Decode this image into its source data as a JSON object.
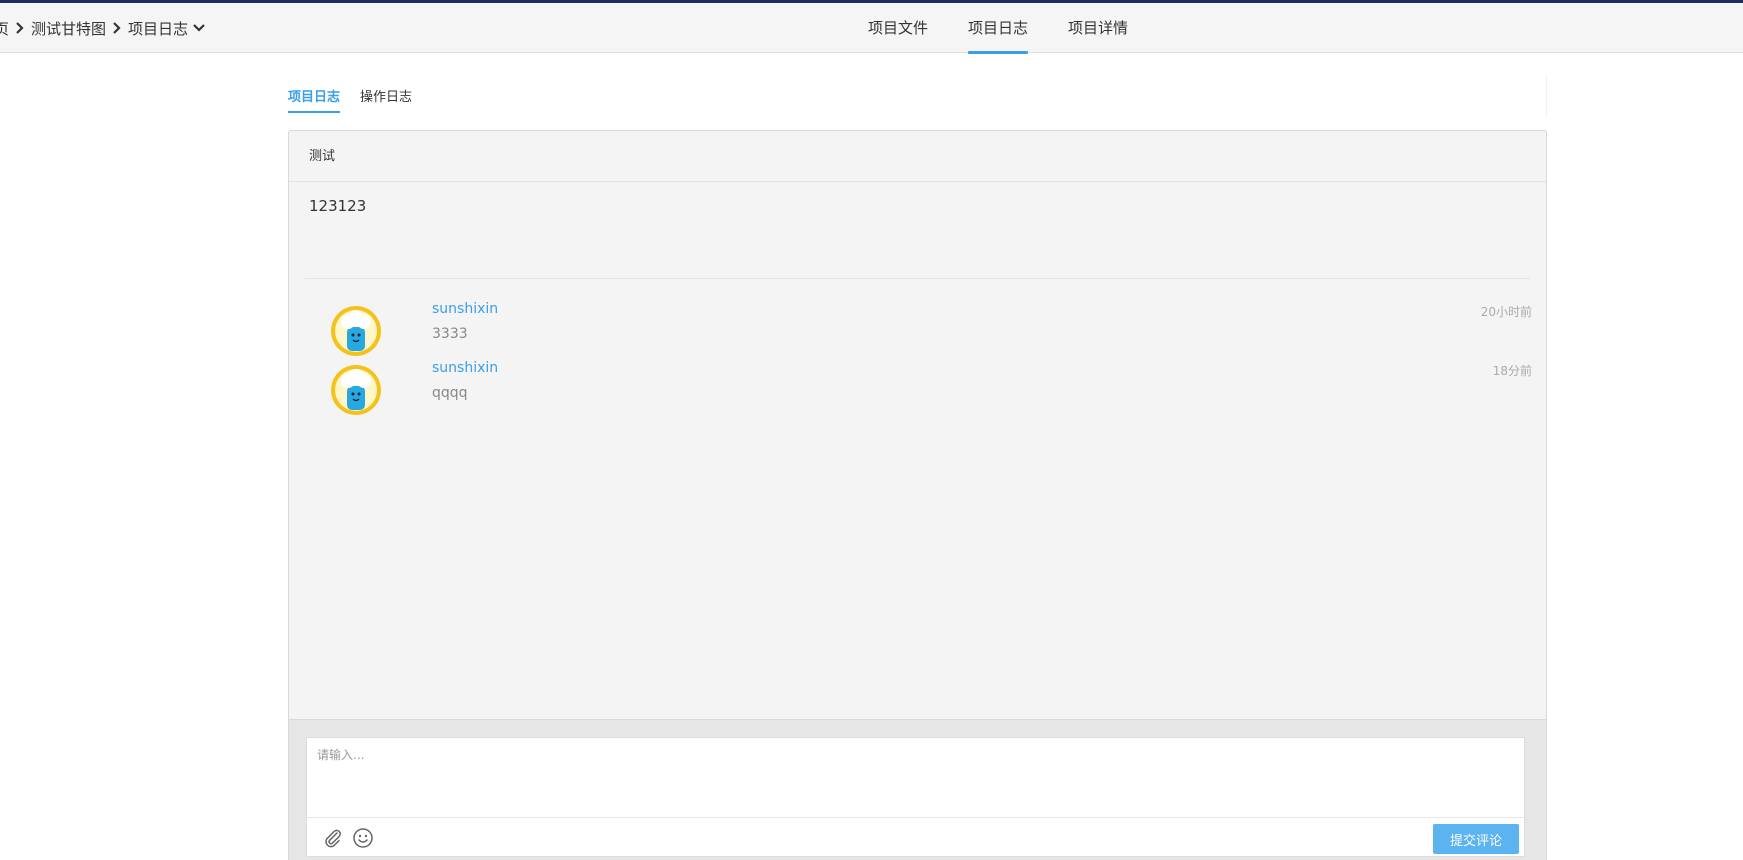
{
  "header": {
    "breadcrumb": [
      {
        "label": "页"
      },
      {
        "label": "测试甘特图"
      },
      {
        "label": "项目日志"
      }
    ],
    "nav": [
      {
        "label": "项目文件",
        "active": false
      },
      {
        "label": "项目日志",
        "active": true
      },
      {
        "label": "项目详情",
        "active": false
      }
    ]
  },
  "subtabs": [
    {
      "label": "项目日志",
      "active": true
    },
    {
      "label": "操作日志",
      "active": false
    }
  ],
  "log": {
    "title": "测试",
    "body": "123123"
  },
  "comments": [
    {
      "user": "sunshixin",
      "text": "3333",
      "time": "20小时前"
    },
    {
      "user": "sunshixin",
      "text": "qqqq",
      "time": "18分前"
    }
  ],
  "composer": {
    "placeholder": "请输入...",
    "submit_label": "提交评论"
  },
  "colors": {
    "accent": "#3a9ee8",
    "submit_button": "#5bb3ef",
    "top_bar": "#1f2d5c"
  },
  "icons": {
    "breadcrumb_separator": "chevron-right-icon",
    "breadcrumb_dropdown": "chevron-down-icon",
    "attach": "paperclip-icon",
    "emoji": "smiley-icon",
    "avatar": "cloud-character-avatar"
  }
}
